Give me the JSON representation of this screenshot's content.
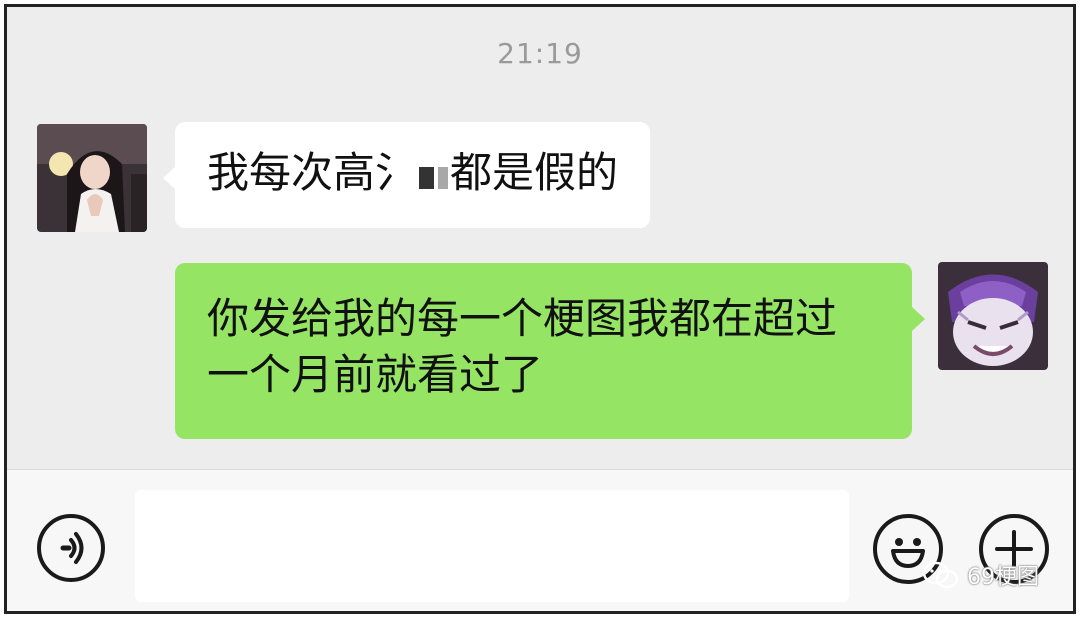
{
  "chat": {
    "timestamp": "21:19",
    "messages": [
      {
        "side": "left",
        "text_before": "我每次高",
        "text_mid": "氵",
        "text_after": "都是假的"
      },
      {
        "side": "right",
        "line1": "你发给我的每一个梗图我都在超过",
        "line2": "一个月前就看过了"
      }
    ]
  },
  "input_bar": {
    "placeholder": "",
    "voice_icon": "voice-icon",
    "emoji_icon": "emoji-icon",
    "plus_icon": "plus-icon"
  },
  "watermark": {
    "text": "69梗图"
  },
  "colors": {
    "chat_bg": "#ededed",
    "incoming_bubble": "#ffffff",
    "outgoing_bubble": "#95e464",
    "timestamp": "#9a9a9a"
  }
}
